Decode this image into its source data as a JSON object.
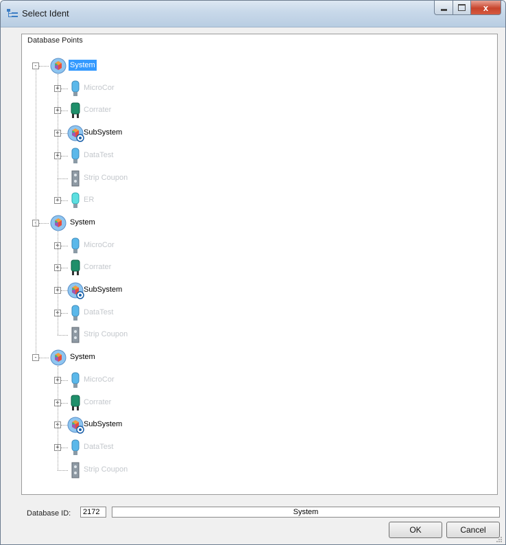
{
  "window": {
    "title": "Select Ident",
    "minimize_label": "",
    "maximize_label": "",
    "close_label": "x"
  },
  "panel": {
    "header": "Database Points"
  },
  "tree": {
    "groups": [
      {
        "label": "System",
        "selected": true,
        "children": [
          {
            "label": "MicroCor",
            "icon": "probe-icon",
            "muted": true,
            "expandable": true
          },
          {
            "label": "Corrater",
            "icon": "corrater-icon",
            "muted": true,
            "expandable": true
          },
          {
            "label": "SubSystem",
            "icon": "subsystem-icon",
            "muted": false,
            "expandable": true
          },
          {
            "label": "DataTest",
            "icon": "probe-icon",
            "muted": true,
            "expandable": true
          },
          {
            "label": "Strip Coupon",
            "icon": "coupon-icon",
            "muted": true,
            "expandable": false
          },
          {
            "label": "ER",
            "icon": "er-probe-icon",
            "muted": true,
            "expandable": true
          }
        ]
      },
      {
        "label": "System",
        "selected": false,
        "children": [
          {
            "label": "MicroCor",
            "icon": "probe-icon",
            "muted": true,
            "expandable": true
          },
          {
            "label": "Corrater",
            "icon": "corrater-icon",
            "muted": true,
            "expandable": true
          },
          {
            "label": "SubSystem",
            "icon": "subsystem-icon",
            "muted": false,
            "expandable": true
          },
          {
            "label": "DataTest",
            "icon": "probe-icon",
            "muted": true,
            "expandable": true
          },
          {
            "label": "Strip Coupon",
            "icon": "coupon-icon",
            "muted": true,
            "expandable": false
          }
        ]
      },
      {
        "label": "System",
        "selected": false,
        "children": [
          {
            "label": "MicroCor",
            "icon": "probe-icon",
            "muted": true,
            "expandable": true
          },
          {
            "label": "Corrater",
            "icon": "corrater-icon",
            "muted": true,
            "expandable": true
          },
          {
            "label": "SubSystem",
            "icon": "subsystem-icon",
            "muted": false,
            "expandable": true
          },
          {
            "label": "DataTest",
            "icon": "probe-icon",
            "muted": true,
            "expandable": true
          },
          {
            "label": "Strip Coupon",
            "icon": "coupon-icon",
            "muted": true,
            "expandable": false
          }
        ]
      }
    ]
  },
  "footer": {
    "database_id_label": "Database ID:",
    "database_id_value": "2172",
    "selected_name": "System",
    "ok_label": "OK",
    "cancel_label": "Cancel"
  },
  "colors": {
    "selection": "#3399ff",
    "muted_text": "#c3c7cc",
    "probe_blue": "#5bb8ea",
    "corrater_green": "#1f8f6a"
  }
}
